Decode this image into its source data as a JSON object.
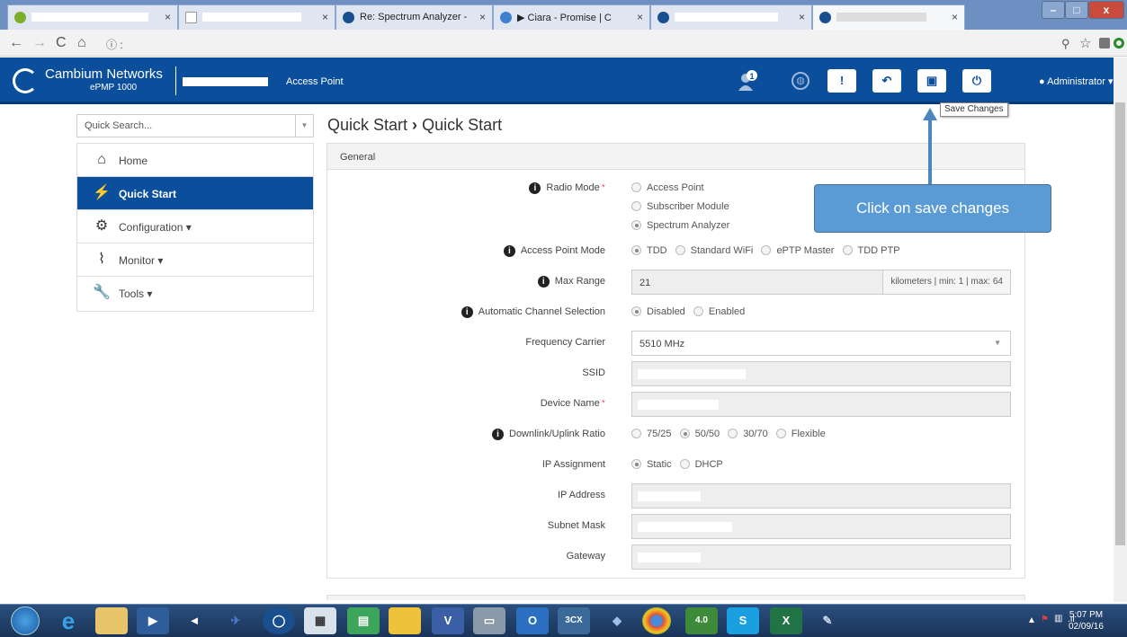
{
  "browser": {
    "tabs": [
      {
        "title": "",
        "active": false
      },
      {
        "title": "",
        "active": false
      },
      {
        "title": "Re: Spectrum Analyzer -",
        "active": false
      },
      {
        "title": "▶ Ciara - Promise | C",
        "active": false
      },
      {
        "title": "",
        "active": false
      },
      {
        "title": "",
        "active": true
      }
    ],
    "url": "ⓘ :"
  },
  "header": {
    "brand": "Cambium Networks",
    "model": "ePMP 1000",
    "mode": "Access Point",
    "notification_count": "1",
    "user": "Administrator",
    "tooltip": "Save Changes"
  },
  "sidebar": {
    "search_placeholder": "Quick Search...",
    "items": [
      {
        "label": "Home",
        "icon": "home-icon"
      },
      {
        "label": "Quick Start",
        "icon": "runner-icon",
        "active": true
      },
      {
        "label": "Configuration",
        "icon": "gear-icon"
      },
      {
        "label": "Monitor",
        "icon": "pulse-icon"
      },
      {
        "label": "Tools",
        "icon": "wrench-icon"
      }
    ]
  },
  "main": {
    "breadcrumb_a": "Quick Start",
    "breadcrumb_b": "Quick Start",
    "section": "General",
    "radio_mode": {
      "label": "Radio Mode",
      "options": [
        "Access Point",
        "Subscriber Module",
        "Spectrum Analyzer"
      ],
      "selected": "Spectrum Analyzer"
    },
    "ap_mode": {
      "label": "Access Point Mode",
      "options": [
        "TDD",
        "Standard WiFi",
        "ePTP Master",
        "TDD PTP"
      ],
      "selected": "TDD"
    },
    "max_range": {
      "label": "Max Range",
      "value": "21",
      "unit": "kilometers | min: 1 | max: 64"
    },
    "acs": {
      "label": "Automatic Channel Selection",
      "options": [
        "Disabled",
        "Enabled"
      ],
      "selected": "Disabled"
    },
    "frequency": {
      "label": "Frequency Carrier",
      "value": "5510 MHz"
    },
    "ssid": {
      "label": "SSID"
    },
    "device_name": {
      "label": "Device Name"
    },
    "ratio": {
      "label": "Downlink/Uplink Ratio",
      "options": [
        "75/25",
        "50/50",
        "30/70",
        "Flexible"
      ],
      "selected": "50/50"
    },
    "ip_assign": {
      "label": "IP Assignment",
      "options": [
        "Static",
        "DHCP"
      ],
      "selected": "Static"
    },
    "ip_address": {
      "label": "IP Address"
    },
    "subnet": {
      "label": "Subnet Mask"
    },
    "gateway": {
      "label": "Gateway"
    }
  },
  "annotation": {
    "text": "Click on save changes"
  },
  "taskbar": {
    "time": "5:07 PM",
    "date": "02/09/16"
  },
  "colors": {
    "brand": "#0b4f9c",
    "callout": "#5b9bd5"
  }
}
